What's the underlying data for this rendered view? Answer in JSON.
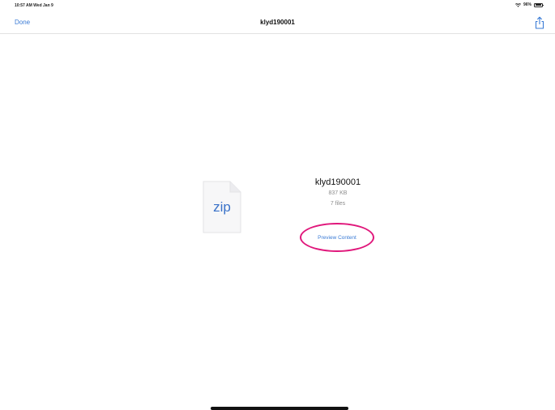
{
  "status_bar": {
    "time_date": "10:57 AM  Wed Jan 9",
    "battery": "96%",
    "battery_level": 0.96
  },
  "nav": {
    "done_label": "Done",
    "title": "klyd190001",
    "share_icon": "share-icon"
  },
  "file": {
    "icon": "zip-file-icon",
    "type_label": "zip",
    "name": "klyd190001",
    "size": "837 KB",
    "count": "7 files",
    "preview_label": "Preview Content"
  },
  "colors": {
    "accent": "#3a7bd5",
    "highlight_ring": "#e0177b"
  }
}
